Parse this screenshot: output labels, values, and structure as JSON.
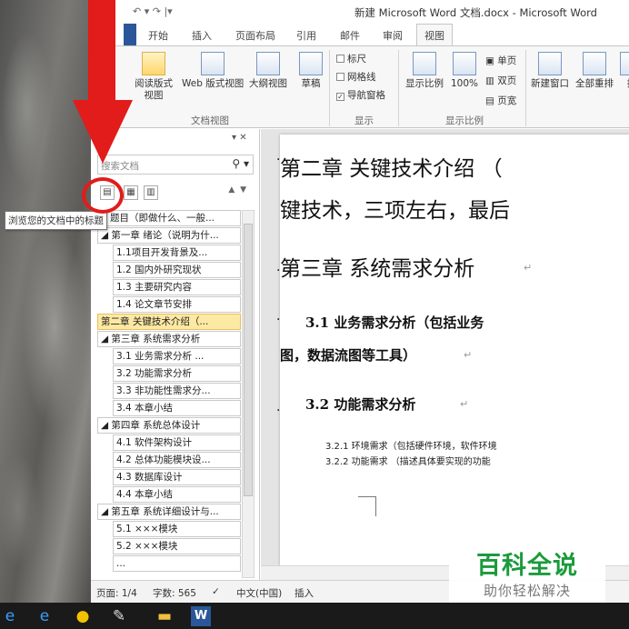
{
  "window": {
    "title": "新建 Microsoft Word 文档.docx - Microsoft Word",
    "qat": "↶ ▾ ↷ |▾"
  },
  "ribbon": {
    "tabs": [
      "开始",
      "插入",
      "页面布局",
      "引用",
      "邮件",
      "审阅",
      "视图"
    ],
    "active_tab": "视图",
    "document_views": {
      "label": "文档视图",
      "reading": "阅读版式\n视图",
      "reading_a": "阅读版式",
      "reading_b": "视图",
      "web": "Web 版式视图",
      "outline": "大纲视图",
      "draft": "草稿"
    },
    "show": {
      "label": "显示",
      "ruler": "标尺",
      "gridlines": "网格线",
      "nav_pane": "导航窗格",
      "nav_checked": "✓"
    },
    "zoom": {
      "label": "显示比例",
      "zoom": "显示比例",
      "percent": "100%",
      "one_page": "单页",
      "two_pages": "双页",
      "page_width": "页宽"
    },
    "window": {
      "new_window": "新建窗口",
      "arrange_all": "全部重排",
      "split": "抗"
    }
  },
  "nav_pane": {
    "controls": "▾ ✕",
    "search_placeholder": "搜索文档",
    "search_icon": "⚲ ▾",
    "tooltip": "浏览您的文档中的标题",
    "tree": [
      {
        "label": "题目（即做什么、一般...",
        "level": 0,
        "selected": false
      },
      {
        "label": "◢ 第一章 绪论（说明为什...",
        "level": 0,
        "selected": false
      },
      {
        "label": "1.1项目开发背景及...",
        "level": 1,
        "selected": false
      },
      {
        "label": "1.2 国内外研究现状",
        "level": 1,
        "selected": false
      },
      {
        "label": "1.3 主要研究内容",
        "level": 1,
        "selected": false
      },
      {
        "label": "1.4 论文章节安排",
        "level": 1,
        "selected": false
      },
      {
        "label": "第二章 关键技术介绍（...",
        "level": 0,
        "selected": true
      },
      {
        "label": "◢ 第三章 系统需求分析",
        "level": 0,
        "selected": false
      },
      {
        "label": "3.1 业务需求分析 ...",
        "level": 1,
        "selected": false
      },
      {
        "label": "3.2 功能需求分析",
        "level": 1,
        "selected": false
      },
      {
        "label": "3.3 非功能性需求分...",
        "level": 1,
        "selected": false
      },
      {
        "label": "3.4 本章小结",
        "level": 1,
        "selected": false
      },
      {
        "label": "◢ 第四章 系统总体设计",
        "level": 0,
        "selected": false
      },
      {
        "label": "4.1 软件架构设计",
        "level": 1,
        "selected": false
      },
      {
        "label": "4.2 总体功能模块设...",
        "level": 1,
        "selected": false
      },
      {
        "label": "4.3 数据库设计",
        "level": 1,
        "selected": false
      },
      {
        "label": "4.4 本章小结",
        "level": 1,
        "selected": false
      },
      {
        "label": "◢ 第五章 系统详细设计与...",
        "level": 0,
        "selected": false
      },
      {
        "label": "5.1 ×××模块",
        "level": 1,
        "selected": false
      },
      {
        "label": "5.2 ×××模块",
        "level": 1,
        "selected": false
      },
      {
        "label": "...",
        "level": 1,
        "selected": false
      }
    ]
  },
  "document": {
    "h_ch2_line1": "第二章  关键技术介绍  （",
    "h_ch2_line2": "键技术，三项左右，最后",
    "h_ch3": "第三章  系统需求分析",
    "h_31_line1": "3.1  业务需求分析（包括业务",
    "h_31_line2": "图，数据流图等工具）",
    "h_32": "3.2  功能需求分析",
    "p_321": "3.2.1 环境需求（包括硬件环境，软件环境",
    "p_322": "3.2.2 功能需求  （描述具体要实现的功能",
    "para_mark": "↵"
  },
  "status_bar": {
    "page": "页面: 1/4",
    "words": "字数: 565",
    "language": "中文(中国)",
    "mode": "插入"
  },
  "watermark": {
    "title": "百科全说",
    "subtitle": "助你轻松解决"
  },
  "colors": {
    "accent": "#2b579a",
    "selected_heading": "#fde9a3",
    "annotation": "#e21b1b",
    "watermark_green": "#1a9b3c"
  }
}
